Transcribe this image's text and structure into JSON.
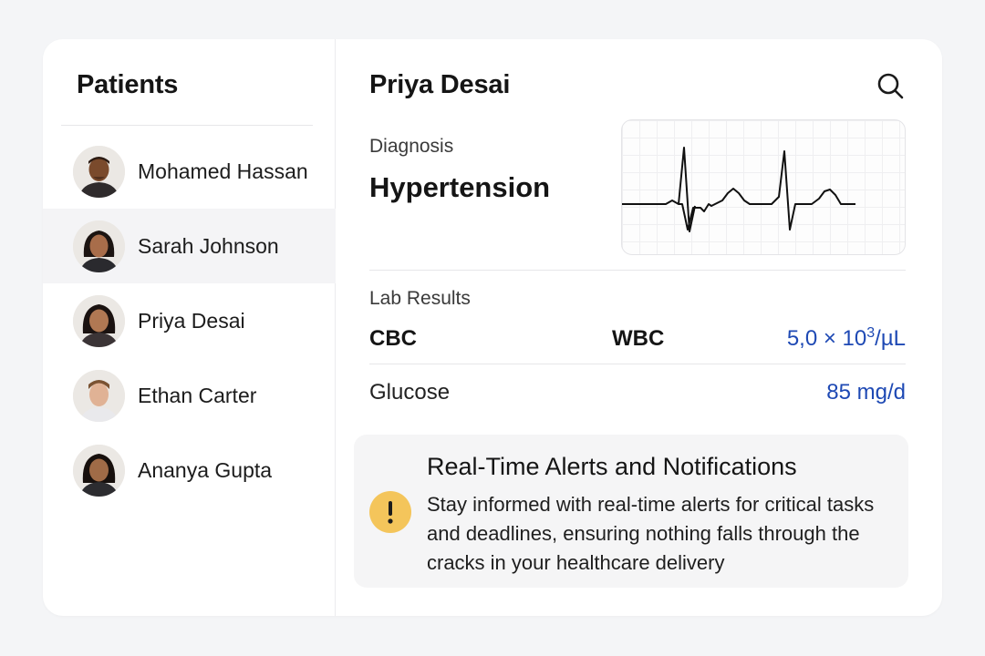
{
  "sidebar": {
    "title": "Patients",
    "patients": [
      {
        "name": "Mohamed Hassan",
        "selected": false
      },
      {
        "name": "Sarah Johnson",
        "selected": true
      },
      {
        "name": "Priya Desai",
        "selected": false
      },
      {
        "name": "Ethan Carter",
        "selected": false
      },
      {
        "name": "Ananya Gupta",
        "selected": false
      }
    ]
  },
  "detail": {
    "patient_name": "Priya Desai",
    "search_icon": "search-icon",
    "diagnosis_label": "Diagnosis",
    "diagnosis_value": "Hypertension",
    "lab_results_label": "Lab Results",
    "lab": {
      "cbc_label": "CBC",
      "wbc_label": "WBC",
      "wbc_value": "5,0 × 10",
      "wbc_exponent": "3",
      "wbc_unit": "/µL",
      "glucose_label": "Glucose",
      "glucose_value": "85 mg/d"
    }
  },
  "alert": {
    "icon": "exclamation-icon",
    "title": "Real-Time Alerts and Notifications",
    "body": "Stay informed with real-time alerts for critical tasks and deadlines, ensuring nothing falls through the cracks in your healthcare delivery"
  },
  "colors": {
    "accent_blue": "#1e49b4",
    "alert_yellow": "#f4c55b",
    "selected_row": "#f4f4f6"
  }
}
